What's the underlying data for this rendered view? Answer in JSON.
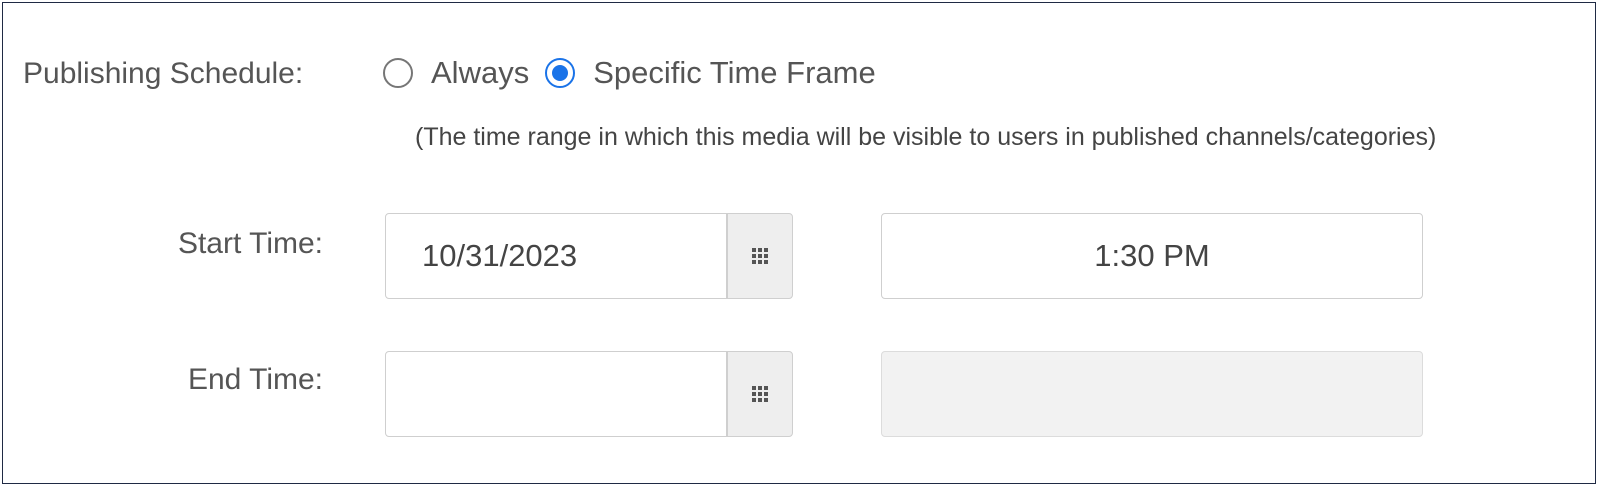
{
  "schedule": {
    "label": "Publishing Schedule:",
    "options": [
      {
        "label": "Always",
        "selected": false
      },
      {
        "label": "Specific Time Frame",
        "selected": true
      }
    ],
    "hint": "(The time range in which this media will be visible to users in published channels/categories)"
  },
  "start": {
    "label": "Start Time:",
    "date_value": "10/31/2023",
    "time_value": "1:30 PM"
  },
  "end": {
    "label": "End Time:",
    "date_value": "",
    "time_value": ""
  },
  "icons": {
    "calendar": "calendar-grid-icon"
  },
  "colors": {
    "accent": "#1a73e8",
    "border": "#cfcfcf",
    "button_bg": "#eeeeee",
    "disabled_bg": "#f2f2f2",
    "frame_border": "#1f2a44"
  }
}
